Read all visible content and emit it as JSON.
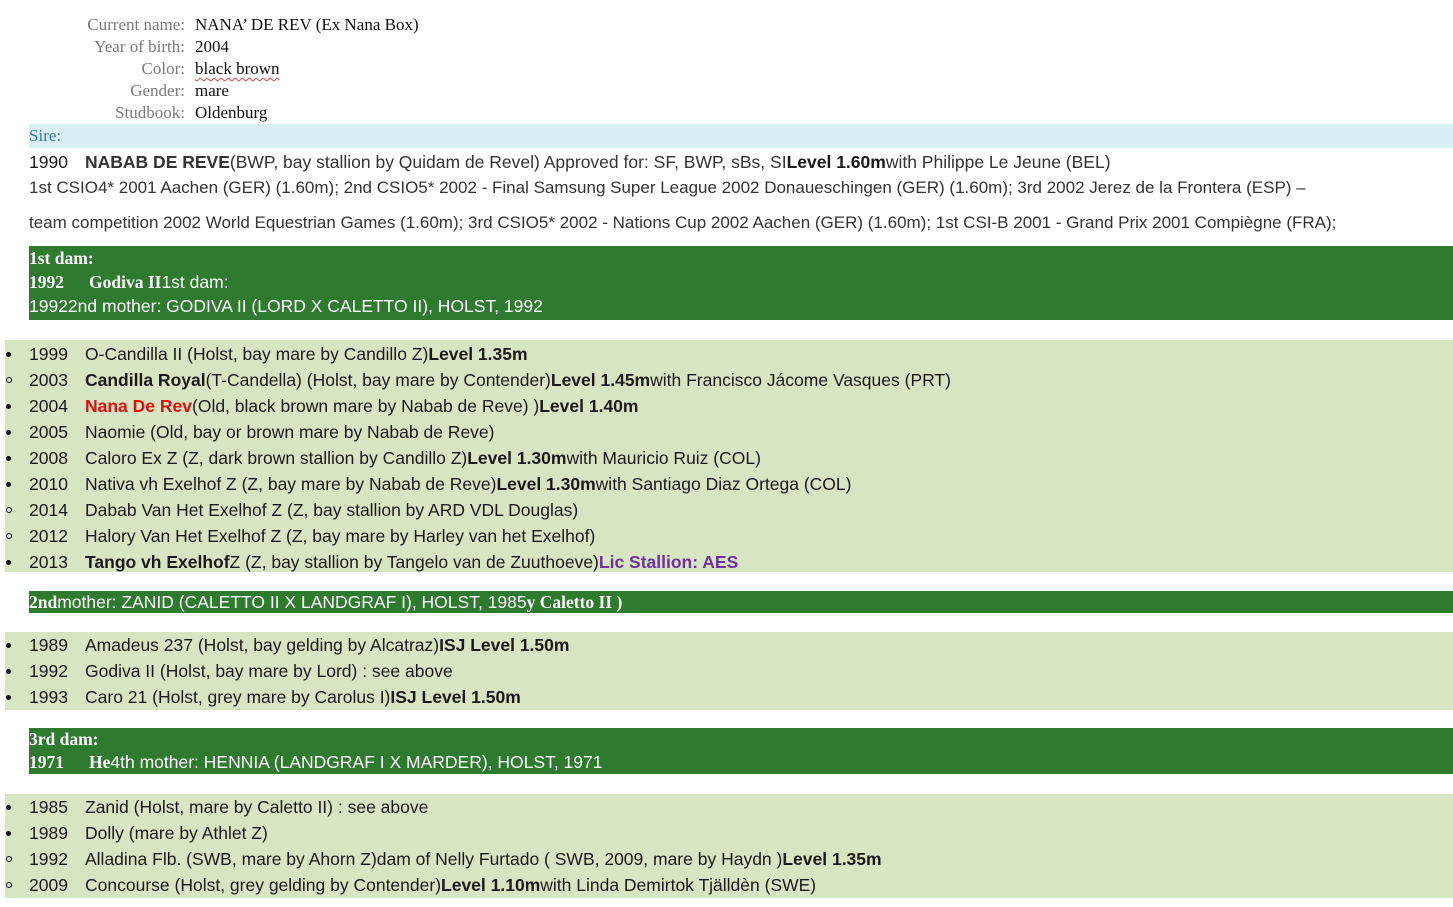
{
  "info": {
    "current_name_label": "Current name:",
    "current_name_value": "NANA’ DE REV (Ex Nana Box)",
    "year_label": "Year of birth:",
    "year_value": "2004",
    "color_label": "Color:",
    "color_value": "black brown",
    "gender_label": "Gender:",
    "gender_value": "mare",
    "studbook_label": "Studbook:",
    "studbook_value": "Oldenburg"
  },
  "sire": {
    "header": "Sire:",
    "year": "1990",
    "name": "NABAB DE REVE",
    "details": " (BWP, bay stallion by Quidam de Revel) Approved for: SF, BWP, sBs, SI ",
    "level": "Level 1.60m",
    "rider": " with Philippe Le Jeune (BEL)",
    "results1": "1st CSIO4* 2001 Aachen (GER) (1.60m); 2nd CSIO5* 2002 - Final Samsung Super League 2002 Donaueschingen (GER) (1.60m); 3rd 2002 Jerez de la Frontera (ESP) –",
    "results2": "team competition 2002 World Equestrian Games (1.60m); 3rd CSIO5* 2002 - Nations Cup 2002 Aachen (GER) (1.60m); 1st CSI-B 2001 - Grand Prix 2001 Compiègne (FRA);"
  },
  "dam1": {
    "line1": "1st dam:",
    "line2_year": "1992",
    "line2_name": "Godiva II",
    "line2_rest": " 1st dam:",
    "line3": "19922nd mother: GODIVA II (LORD X CALETTO II), HOLST, 1992"
  },
  "dam1_offspring": [
    {
      "bullet": "dot",
      "year": "1999",
      "pre": "O-Candilla II (Holst, bay mare by Candillo Z) ",
      "bold": "Level 1.35m",
      "post": ""
    },
    {
      "bullet": "ring",
      "year": "2003",
      "pre_bold": "Candilla Royal",
      "pre": " (T-Candella) (Holst, bay mare by Contender) ",
      "bold": "Level 1.45m",
      "post": " with Francisco Jácome Vasques (PRT)"
    },
    {
      "bullet": "dot",
      "year": "2004",
      "red": "Nana De Rev",
      "pre": " (Old, black brown mare by Nabab de Reve) ) ",
      "bold": "Level 1.40m",
      "post": ""
    },
    {
      "bullet": "dot",
      "year": "2005",
      "pre": "Naomie (Old, bay or brown mare by Nabab de Reve)",
      "bold": "",
      "post": ""
    },
    {
      "bullet": "dot",
      "year": "2008",
      "pre": "Caloro Ex Z (Z, dark brown stallion by Candillo Z) ",
      "bold": "Level 1.30m",
      "post": " with Mauricio Ruiz (COL)"
    },
    {
      "bullet": "dot",
      "year": "2010",
      "pre": "Nativa vh Exelhof Z (Z, bay mare by Nabab de Reve) ",
      "bold": "Level 1.30m",
      "post": " with Santiago Diaz Ortega (COL)"
    },
    {
      "bullet": "ring",
      "year": "2014",
      "pre": "Dabab Van Het Exelhof Z (Z, bay stallion by ARD VDL Douglas)",
      "bold": "",
      "post": ""
    },
    {
      "bullet": "ring",
      "year": "2012",
      "pre": "Halory Van Het Exelhof Z (Z, bay mare by Harley van het Exelhof)",
      "bold": "",
      "post": ""
    },
    {
      "bullet": "dot",
      "year": "2013",
      "pre_bold": "Tango vh Exelhof",
      "pre": " Z (Z, bay stallion by Tangelo van de Zuuthoeve) ",
      "bold": "",
      "purple": "Lic Stallion: AES",
      "post": ""
    }
  ],
  "dam2": {
    "line1_bold": "2nd",
    "line1_rest": " mother: ZANID (CALETTO II X LANDGRAF I), HOLST, 1985",
    "line1_tail": "y Caletto II )"
  },
  "dam2_offspring": [
    {
      "bullet": "dot",
      "year": "1989",
      "pre": "Amadeus 237 (Holst, bay gelding by Alcatraz) ",
      "bold": "ISJ Level 1.50m",
      "post": ""
    },
    {
      "bullet": "dot",
      "year": "1992",
      "pre": "Godiva II (Holst, bay mare by Lord) : see above",
      "bold": "",
      "post": ""
    },
    {
      "bullet": "dot",
      "year": "1993",
      "pre": "Caro 21 (Holst, grey mare by Carolus I) ",
      "bold": "ISJ Level 1.50m",
      "post": ""
    }
  ],
  "dam3": {
    "line1": "3rd dam:",
    "line2_year": "1971",
    "line2_name": "He",
    "line2_rest": "4th mother: HENNIA (LANDGRAF I X MARDER), HOLST, 1971"
  },
  "dam3_offspring": [
    {
      "bullet": "dot",
      "year": "1985",
      "pre": "Zanid (Holst, mare by Caletto II) : see above",
      "bold": "",
      "post": ""
    },
    {
      "bullet": "dot",
      "year": "1989",
      "pre": "Dolly (mare by Athlet Z)",
      "bold": "",
      "post": ""
    },
    {
      "bullet": "ring",
      "year": "1992",
      "pre": "Alladina Flb. (SWB, mare by Ahorn Z)dam of Nelly Furtado ( SWB, 2009, mare by Haydn ) ",
      "bold": "Level 1.35m",
      "post": ""
    },
    {
      "bullet": "ring",
      "year": "2009",
      "pre": "Concourse (Holst, grey gelding by Contender) ",
      "bold": "Level 1.10m",
      "post": " with Linda Demirtok Tjälldèn (SWE)"
    }
  ]
}
